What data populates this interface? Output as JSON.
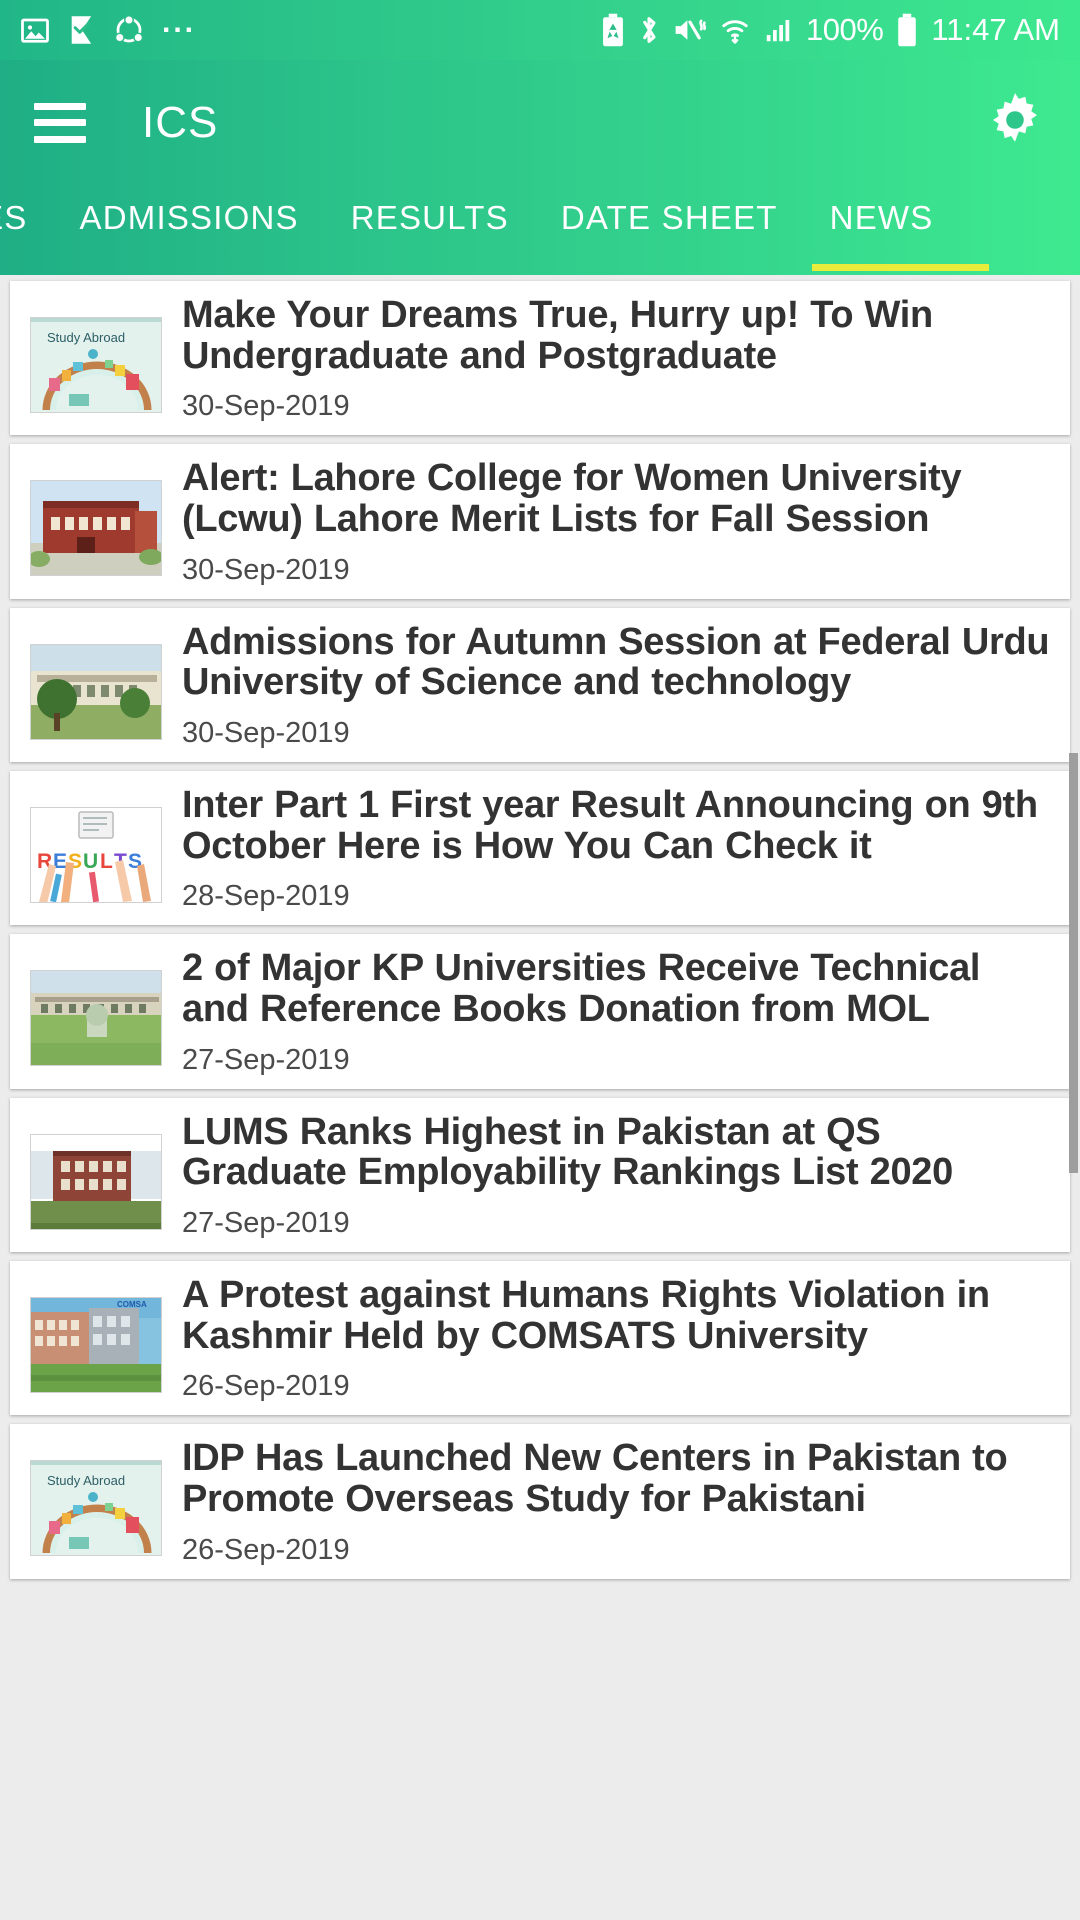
{
  "statusbar": {
    "icons_left": [
      "image-icon",
      "checkmark-flag-icon",
      "share-nodes-icon",
      "more-dots-icon"
    ],
    "dots": "...",
    "icons_right": [
      "battery-saver-icon",
      "bluetooth-icon",
      "mute-vibrate-icon",
      "wifi-icon",
      "signal-icon"
    ],
    "battery_percent": "100%",
    "time": "11:47 AM"
  },
  "appbar": {
    "menu_icon": "hamburger-icon",
    "title": "ICS",
    "settings_icon": "gear-icon"
  },
  "tabs": [
    {
      "label": "EGES",
      "active": false
    },
    {
      "label": "ADMISSIONS",
      "active": false
    },
    {
      "label": "RESULTS",
      "active": false
    },
    {
      "label": "DATE SHEET",
      "active": false
    },
    {
      "label": "NEWS",
      "active": true
    }
  ],
  "colors": {
    "brand_start": "#1fae85",
    "brand_end": "#3eea90",
    "accent_indicator": "#e9ec3a",
    "card_bg": "#ffffff",
    "page_bg": "#ececec",
    "headline": "#333333"
  },
  "news": [
    {
      "headline": "Make Your Dreams True, Hurry up! To Win Undergraduate and Postgraduate",
      "date": "30-Sep-2019",
      "thumb": "study-abroad-illustration"
    },
    {
      "headline": "Alert: Lahore College for Women University (Lcwu) Lahore Merit Lists for Fall Session",
      "date": "30-Sep-2019",
      "thumb": "red-brick-building-photo"
    },
    {
      "headline": "Admissions for Autumn Session at Federal Urdu University of Science and technology",
      "date": "30-Sep-2019",
      "thumb": "campus-building-trees-photo"
    },
    {
      "headline": "Inter Part 1 First year Result Announcing on 9th October Here is How You Can Check it",
      "date": "28-Sep-2019",
      "thumb": "results-hands-illustration"
    },
    {
      "headline": "2 of Major KP Universities Receive Technical and Reference Books Donation from MOL",
      "date": "27-Sep-2019",
      "thumb": "university-lawn-photo"
    },
    {
      "headline": "LUMS Ranks Highest in Pakistan at QS Graduate Employability Rankings List 2020",
      "date": "27-Sep-2019",
      "thumb": "lums-building-photo"
    },
    {
      "headline": "A Protest against Humans Rights Violation in Kashmir Held by COMSATS University",
      "date": "26-Sep-2019",
      "thumb": "comsats-campus-photo"
    },
    {
      "headline": "IDP Has Launched New Centers in Pakistan to Promote Overseas Study for Pakistani",
      "date": "26-Sep-2019",
      "thumb": "study-abroad-illustration"
    }
  ]
}
